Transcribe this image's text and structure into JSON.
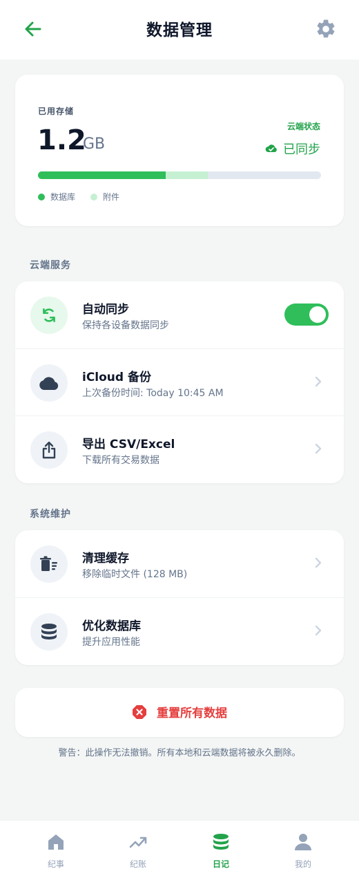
{
  "header": {
    "title": "数据管理",
    "back_icon": "arrow-left-icon",
    "settings_icon": "gear-icon"
  },
  "storage": {
    "label": "已用存储",
    "value": "1.2",
    "unit": "GB",
    "cloud_label": "云端状态",
    "cloud_status": "已同步",
    "usage": {
      "database_fraction": 0.45,
      "attachments_fraction": 0.15
    },
    "legend": [
      {
        "label": "数据库",
        "color": "#2fbe5a"
      },
      {
        "label": "附件",
        "color": "#c5f0d2"
      }
    ]
  },
  "cloud_section": {
    "title": "云端服务",
    "items": [
      {
        "title": "自动同步",
        "subtitle": "保持各设备数据同步",
        "icon": "sync-icon",
        "toggle_on": true
      },
      {
        "title": "iCloud 备份",
        "subtitle": "上次备份时间: Today 10:45 AM",
        "icon": "cloud-icon"
      },
      {
        "title": "导出 CSV/Excel",
        "subtitle": "下载所有交易数据",
        "icon": "share-icon"
      }
    ]
  },
  "maintenance_section": {
    "title": "系统维护",
    "items": [
      {
        "title": "清理缓存",
        "subtitle": "移除临时文件 (128 MB)",
        "icon": "trash-icon"
      },
      {
        "title": "优化数据库",
        "subtitle": "提升应用性能",
        "icon": "database-icon"
      }
    ]
  },
  "reset": {
    "label": "重置所有数据",
    "warning": "警告：此操作无法撤销。所有本地和云端数据将被永久删除。"
  },
  "bottom_nav": [
    {
      "label": "纪事",
      "icon": "home-icon",
      "active": false
    },
    {
      "label": "纪账",
      "icon": "trend-icon",
      "active": false
    },
    {
      "label": "日记",
      "icon": "database-icon",
      "active": true
    },
    {
      "label": "我的",
      "icon": "user-icon",
      "active": false
    }
  ],
  "colors": {
    "accent": "#22a34a",
    "danger": "#e53e3e",
    "muted": "#64748b"
  }
}
